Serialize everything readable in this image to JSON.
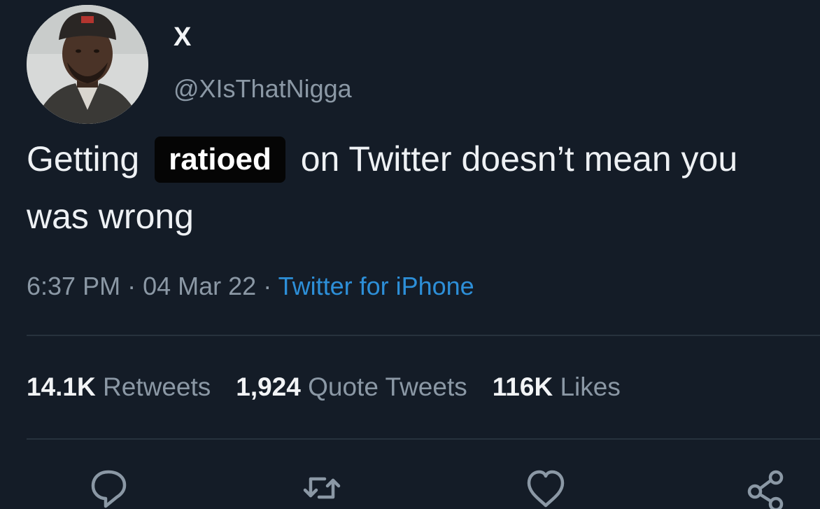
{
  "tweet": {
    "author": {
      "display_name": "X",
      "handle": "@XIsThatNigga",
      "avatar_icon": "user-avatar-photo"
    },
    "text": {
      "before": "Getting",
      "redacted": "ratioed",
      "after": "on Twitter doesn’t mean you was wrong"
    },
    "meta": {
      "time": "6:37 PM",
      "separator1": "·",
      "date": "04 Mar 22",
      "separator2": "·",
      "source": "Twitter for iPhone"
    },
    "stats": [
      {
        "count": "14.1K",
        "label": "Retweets"
      },
      {
        "count": "1,924",
        "label": "Quote Tweets"
      },
      {
        "count": "116K",
        "label": "Likes"
      }
    ],
    "actions": [
      {
        "icon": "reply-icon"
      },
      {
        "icon": "retweet-icon"
      },
      {
        "icon": "like-icon"
      },
      {
        "icon": "share-icon"
      }
    ]
  },
  "colors": {
    "background": "#141c27",
    "text_primary": "#eef1f4",
    "text_secondary": "#8b98a5",
    "link": "#2d8fd8",
    "redaction_box": "#050505"
  }
}
